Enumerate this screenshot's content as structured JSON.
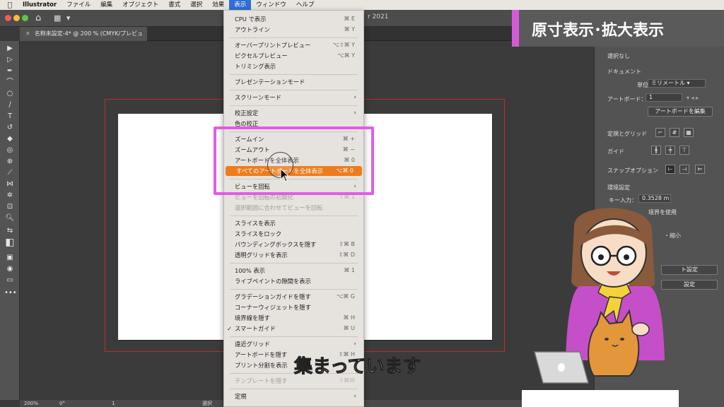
{
  "menubar": {
    "items": [
      "Illustrator",
      "ファイル",
      "編集",
      "オブジェクト",
      "書式",
      "選択",
      "効果",
      "表示",
      "ウィンドウ",
      "ヘルプ"
    ],
    "active": "表示"
  },
  "app": {
    "title_fragment": "r 2021"
  },
  "document": {
    "tab_label": "名称未設定-4* @ 200 % (CMYK/プレビュー)"
  },
  "overlay_title": "原寸表示･拡大表示",
  "view_menu": {
    "items": [
      {
        "label": "CPU で表示",
        "shortcut": "⌘ E"
      },
      {
        "label": "アウトライン",
        "shortcut": "⌘ Y"
      },
      {
        "sep": true
      },
      {
        "label": "オーバープリントプレビュー",
        "shortcut": "⌥⇧⌘ Y"
      },
      {
        "label": "ピクセルプレビュー",
        "shortcut": "⌥⌘ Y"
      },
      {
        "label": "トリミング表示",
        "shortcut": ""
      },
      {
        "sep": true
      },
      {
        "label": "プレゼンテーションモード",
        "shortcut": ""
      },
      {
        "sep": true
      },
      {
        "label": "スクリーンモード",
        "shortcut": "",
        "submenu": true
      },
      {
        "sep": true
      },
      {
        "label": "校正設定",
        "shortcut": "",
        "submenu": true
      },
      {
        "label": "色の校正",
        "shortcut": ""
      },
      {
        "sep": true
      },
      {
        "label": "ズームイン",
        "shortcut": "⌘ +"
      },
      {
        "label": "ズームアウト",
        "shortcut": "⌘ −"
      },
      {
        "label": "アートボードを全体表示",
        "shortcut": "⌘ 0"
      },
      {
        "label": "すべてのアートボードを全体表示",
        "shortcut": "⌥⌘ 0",
        "highlight": true
      },
      {
        "sep": true
      },
      {
        "label": "ビューを回転",
        "shortcut": "",
        "submenu": true
      },
      {
        "label": "ビューを回転の初期化",
        "shortcut": "⇧⌘ 1",
        "disabled": true
      },
      {
        "label": "選択範囲に合わせてビューを回転",
        "shortcut": "",
        "disabled": true
      },
      {
        "sep": true
      },
      {
        "label": "スライスを表示",
        "shortcut": ""
      },
      {
        "label": "スライスをロック",
        "shortcut": ""
      },
      {
        "label": "バウンディングボックスを隠す",
        "shortcut": "⇧⌘ B"
      },
      {
        "label": "透明グリッドを表示",
        "shortcut": "⇧⌘ D"
      },
      {
        "sep": true
      },
      {
        "label": "100% 表示",
        "shortcut": "⌘ 1"
      },
      {
        "label": "ライブペイントの隙間を表示",
        "shortcut": ""
      },
      {
        "sep": true
      },
      {
        "label": "グラデーションガイドを隠す",
        "shortcut": "⌥⌘ G"
      },
      {
        "label": "コーナーウィジェットを隠す",
        "shortcut": ""
      },
      {
        "label": "境界線を隠す",
        "shortcut": "⌘ H"
      },
      {
        "label": "スマートガイド",
        "shortcut": "⌘ U",
        "checked": true
      },
      {
        "sep": true
      },
      {
        "label": "遠近グリッド",
        "shortcut": "",
        "submenu": true
      },
      {
        "label": "アートボードを隠す",
        "shortcut": "⇧⌘ H"
      },
      {
        "label": "プリント分割を表示",
        "shortcut": ""
      },
      {
        "sep": true
      },
      {
        "label": "テンプレートを隠す",
        "shortcut": "⇧⌘W",
        "disabled": true
      },
      {
        "sep": true
      },
      {
        "label": "定規",
        "shortcut": "",
        "submenu": true
      }
    ]
  },
  "properties": {
    "no_selection": "選択なし",
    "document_heading": "ドキュメント",
    "units_label": "単位：",
    "units_value": "ミリメートル",
    "artboard_label": "アートボード：",
    "artboard_value": "1",
    "edit_artboard_button": "アートボードを編集",
    "rulers_grids": "定規とグリッド",
    "guides": "ガイド",
    "snap_options": "スナップオプション",
    "prefs_heading": "環境設定",
    "key_increment_label": "キー入力：",
    "key_increment_value": "0.3528 m",
    "use_bounds": "境界を使用",
    "scale_fragment": "・縮小",
    "button1_fragment": "ト設定",
    "button2_fragment": "設定"
  },
  "status": {
    "zoom": "200%",
    "rotation": "0°",
    "artboard": "1",
    "selection": "選択"
  },
  "subtitle": "集まっています",
  "colors": {
    "menu_highlight": "#ef7c1a",
    "callout_border": "#e35be6",
    "bleed": "#c22b2b"
  }
}
